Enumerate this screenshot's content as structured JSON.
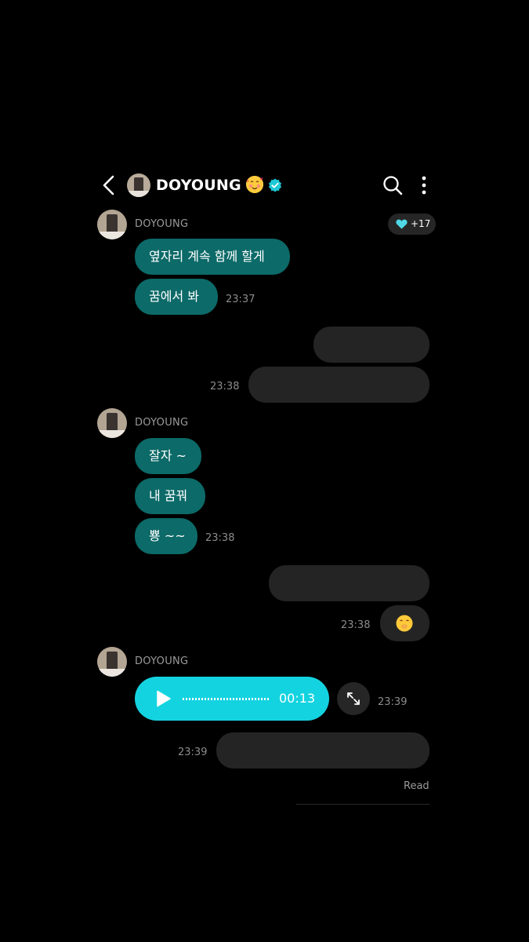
{
  "header": {
    "title": "DOYOUNG",
    "title_emoji": "smiling-face-with-hearts",
    "verified_icon": "verified-badge-icon",
    "accent": "#1ec8d6"
  },
  "reaction": {
    "icon": "heart-icon",
    "count": "+17",
    "color": "#4fd7e4"
  },
  "groups": [
    {
      "sender": "DOYOUNG",
      "messages": [
        "옆자리 계속 함께 할게",
        "꿈에서 봐"
      ],
      "time": "23:37"
    },
    {
      "mine": true,
      "time": "23:38"
    },
    {
      "sender": "DOYOUNG",
      "messages": [
        "잘자 ~",
        "내 꿈꿔",
        "뿅 ~~"
      ],
      "time": "23:38"
    },
    {
      "mine": true,
      "time": "23:38",
      "emoji": "shushing-face"
    },
    {
      "sender": "DOYOUNG",
      "voice": {
        "duration": "00:13"
      },
      "time": "23:39"
    },
    {
      "mine": true,
      "time": "23:39"
    }
  ],
  "status": {
    "read_label": "Read"
  },
  "colors": {
    "artist_bubble": "#0c6a68",
    "voice_bubble": "#14d3e0",
    "my_bubble": "#242424"
  }
}
